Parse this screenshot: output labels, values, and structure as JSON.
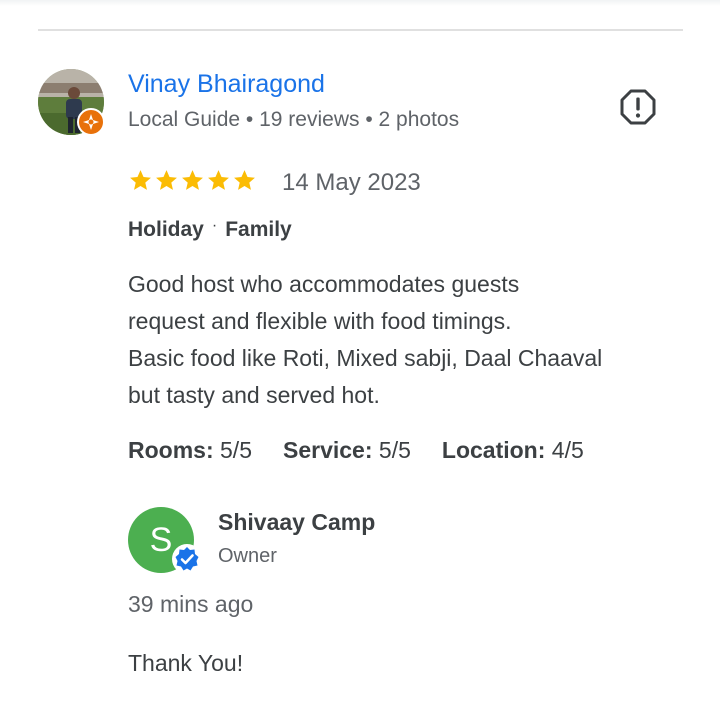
{
  "review": {
    "reviewer": {
      "name": "Vinay Bhairagond",
      "badge": "Local Guide",
      "reviews_count": "19 reviews",
      "photos_count": "2 photos",
      "avatar_icon": "reviewer-photo",
      "guide_badge_icon": "local-guide-star-icon"
    },
    "rating": 5,
    "max_rating": 5,
    "date": "14 May 2023",
    "trip_tags": [
      "Holiday",
      "Family"
    ],
    "text_lines": [
      "Good host who accommodates guests",
      "request and flexible with food timings.",
      "Basic food like Roti, Mixed sabji, Daal Chaaval",
      "but tasty and served hot."
    ],
    "sub_ratings": [
      {
        "label": "Rooms:",
        "value": "5/5"
      },
      {
        "label": "Service:",
        "value": "5/5"
      },
      {
        "label": "Location:",
        "value": "4/5"
      }
    ],
    "report_icon": "report-icon"
  },
  "owner_reply": {
    "name": "Shivaay Camp",
    "role": "Owner",
    "avatar_letter": "S",
    "time": "39 mins ago",
    "text": "Thank You!"
  },
  "colors": {
    "link_blue": "#1a73e8",
    "star_gold": "#fbbc04",
    "owner_avatar_green": "#4caf50",
    "guide_orange": "#e8710a",
    "verified_blue": "#1a73e8",
    "text_primary": "#3c4043",
    "text_secondary": "#5f6368"
  }
}
